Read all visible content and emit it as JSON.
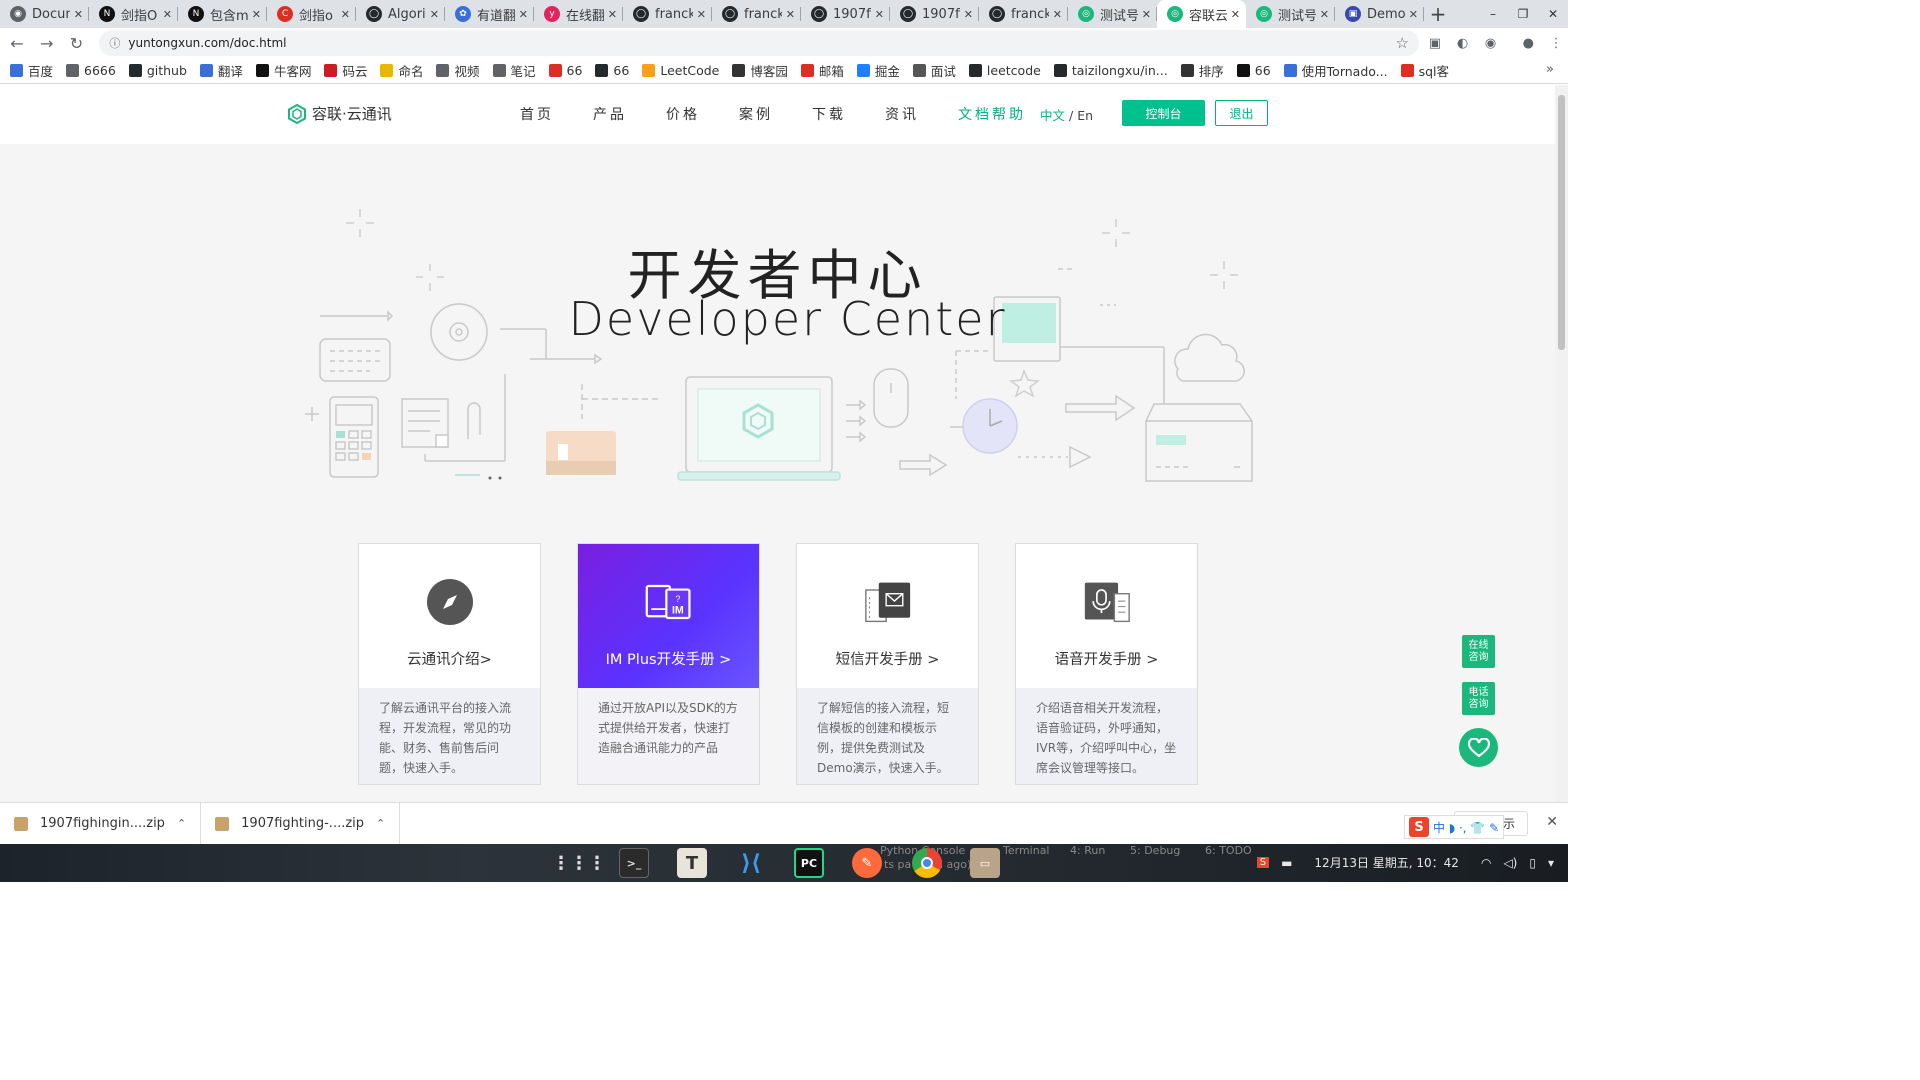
{
  "browser": {
    "tabs": [
      {
        "label": "Docum",
        "color": "#5f6368",
        "glyph": "◉"
      },
      {
        "label": "剑指O",
        "color": "#111111",
        "glyph": "N"
      },
      {
        "label": "包含m",
        "color": "#111111",
        "glyph": "N"
      },
      {
        "label": "剑指o",
        "color": "#d93025",
        "glyph": "C"
      },
      {
        "label": "Algori",
        "color": "#24292e",
        "glyph": "◯"
      },
      {
        "label": "有道翻",
        "color": "#3a6fd8",
        "glyph": "✿"
      },
      {
        "label": "在线翻",
        "color": "#e0245e",
        "glyph": "y"
      },
      {
        "label": "franck",
        "color": "#24292e",
        "glyph": "◯"
      },
      {
        "label": "franck",
        "color": "#24292e",
        "glyph": "◯"
      },
      {
        "label": "1907fi",
        "color": "#24292e",
        "glyph": "◯"
      },
      {
        "label": "1907fi",
        "color": "#24292e",
        "glyph": "◯"
      },
      {
        "label": "franck",
        "color": "#24292e",
        "glyph": "◯"
      },
      {
        "label": "测试号",
        "color": "#1bb77c",
        "glyph": "◎"
      },
      {
        "label": "容联云",
        "color": "#1bb77c",
        "glyph": "◎",
        "active": true
      },
      {
        "label": "测试号",
        "color": "#1bb77c",
        "glyph": "◎"
      },
      {
        "label": "Demo",
        "color": "#3949ab",
        "glyph": "▣"
      }
    ],
    "new_tab": "+",
    "window_controls": [
      "–",
      "❐",
      "✕"
    ],
    "url": "yuntongxun.com/doc.html",
    "bookmarks": [
      {
        "label": "百度",
        "color": "#3a6fd8"
      },
      {
        "label": "6666",
        "color": "#5f6368"
      },
      {
        "label": "github",
        "color": "#24292e"
      },
      {
        "label": "翻译",
        "color": "#3a6fd8"
      },
      {
        "label": "牛客网",
        "color": "#111111"
      },
      {
        "label": "码云",
        "color": "#c71d23"
      },
      {
        "label": "命名",
        "color": "#e6b800"
      },
      {
        "label": "视频",
        "color": "#5f6368"
      },
      {
        "label": "笔记",
        "color": "#5f6368"
      },
      {
        "label": "66",
        "color": "#d93025"
      },
      {
        "label": "66",
        "color": "#24292e"
      },
      {
        "label": "LeetCode",
        "color": "#f89f1b"
      },
      {
        "label": "博客园",
        "color": "#333333"
      },
      {
        "label": "邮箱",
        "color": "#d93025"
      },
      {
        "label": "掘金",
        "color": "#1e80ff"
      },
      {
        "label": "面试",
        "color": "#555555"
      },
      {
        "label": "leetcode",
        "color": "#24292e"
      },
      {
        "label": "taizilongxu/in...",
        "color": "#24292e"
      },
      {
        "label": "排序",
        "color": "#333333"
      },
      {
        "label": "66",
        "color": "#111111"
      },
      {
        "label": "使用Tornado...",
        "color": "#3a6fd8"
      },
      {
        "label": "sql客",
        "color": "#d93025"
      }
    ],
    "bookmarks_more": "»"
  },
  "site": {
    "logo_text": "容联·云通讯",
    "nav": [
      {
        "label": "首页"
      },
      {
        "label": "产品"
      },
      {
        "label": "价格"
      },
      {
        "label": "案例"
      },
      {
        "label": "下载"
      },
      {
        "label": "资讯"
      },
      {
        "label": "文档帮助",
        "active": true
      }
    ],
    "lang_zh": "中文",
    "lang_sep": " / ",
    "lang_en": "En",
    "console_button": "控制台",
    "logout_button": "退出",
    "accent_color": "#00b386"
  },
  "hero": {
    "title_zh": "开发者中心",
    "title_en": "Developer Center"
  },
  "cards": [
    {
      "title": "云通讯介绍>",
      "desc": "了解云通讯平台的接入流程，开发流程，常见的功能、财务、售前售后问题，快速入手。",
      "icon": "compass-icon"
    },
    {
      "title": "IM Plus开发手册 >",
      "desc": "通过开放API以及SDK的方式提供给开发者，快速打造融合通讯能力的产品",
      "icon": "im-book-icon",
      "featured": true
    },
    {
      "title": "短信开发手册 >",
      "desc": "了解短信的接入流程，短信模板的创建和模板示例，提供免费测试及Demo演示，快速入手。",
      "icon": "sms-icon"
    },
    {
      "title": "语音开发手册 >",
      "desc": "介绍语音相关开发流程，语音验证码，外呼通知，IVR等，介绍呼叫中心，坐席会议管理等接口。",
      "icon": "microphone-icon"
    }
  ],
  "float": {
    "online": "在线\n咨询",
    "phone": "电话\n咨询"
  },
  "downloads": {
    "items": [
      {
        "name": "1907fighingin....zip"
      },
      {
        "name": "1907fighting-....zip"
      }
    ],
    "show_all": "全部显示",
    "ime_label": "中 ◗ ·, 👕 ✎"
  },
  "taskbar": {
    "clock": "12月13日 星期五, 10：42",
    "faint_labels": [
      "Python Console",
      "Terminal",
      "4: Run",
      "5: Debug",
      "6: TODO"
    ],
    "faint_overlay": "ts pa    (a mi    ago)"
  }
}
